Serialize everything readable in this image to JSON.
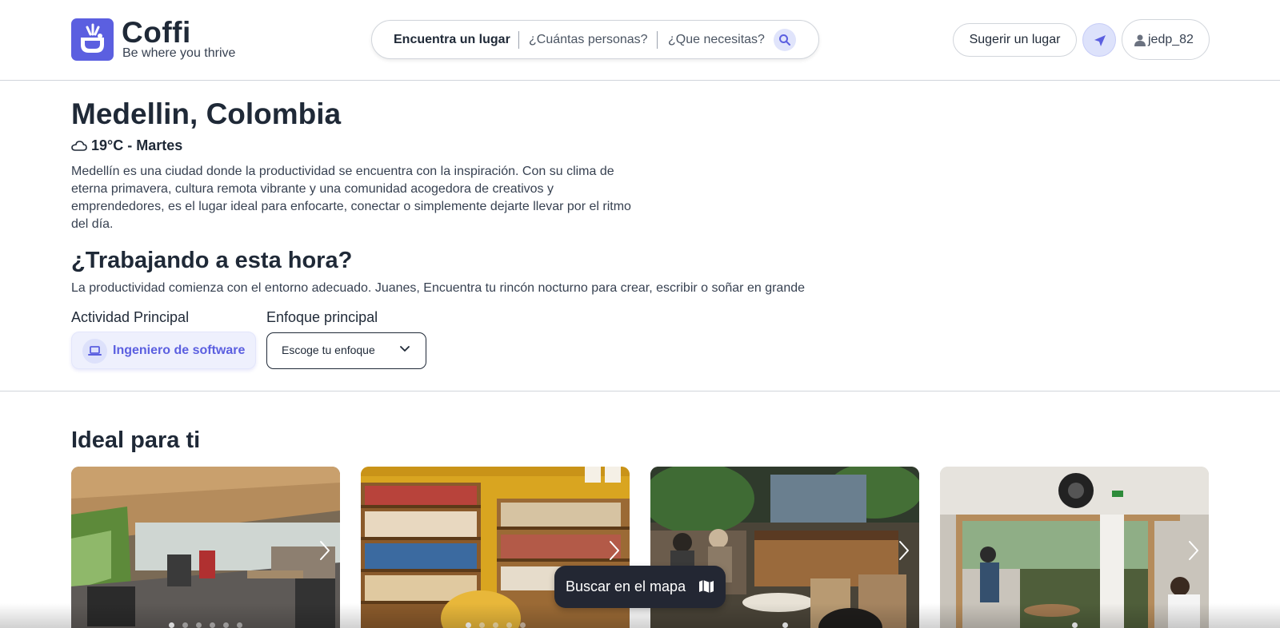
{
  "header": {
    "brand_name": "Coffi",
    "tagline": "Be where you thrive",
    "logo_icon": "cup-logo-icon",
    "search": {
      "place_label": "Encuentra un lugar",
      "people_label": "¿Cuántas personas?",
      "needs_label": "¿Que necesitas?",
      "search_icon": "search-icon"
    },
    "suggest_label": "Sugerir un lugar",
    "location_icon": "navigation-arrow-icon",
    "user_icon": "user-icon",
    "username": "jedp_82"
  },
  "city": {
    "title": "Medellin, Colombia",
    "weather_icon": "cloud-icon",
    "weather": "19°C - Martes",
    "description": "Medellín es una ciudad donde la productividad se encuentra con la inspiración. Con su clima de eterna primavera, cultura remota vibrante y una comunidad acogedora de creativos y emprendedores, es el lugar ideal para enfocarte, conectar o simplemente dejarte llevar por el ritmo del día."
  },
  "working": {
    "title": "¿Trabajando a esta hora?",
    "subtitle": "La productividad comienza con el entorno adecuado. Juanes, Encuentra tu rincón nocturno para crear, escribir o soñar en grande"
  },
  "activity": {
    "label": "Actividad Principal",
    "chip_icon": "laptop-icon",
    "chip_label": "Ingeniero de software"
  },
  "focus": {
    "label": "Enfoque principal",
    "value": "Escoge tu enfoque",
    "chevron_icon": "chevron-down-icon"
  },
  "ideal": {
    "title": "Ideal para ti",
    "cards": [
      {
        "photo": "terrace-cafe-photo",
        "dot_count": 6,
        "active_dot": 0
      },
      {
        "photo": "bookshelf-cafe-photo",
        "dot_count": 5,
        "active_dot": 0
      },
      {
        "photo": "bar-cafe-photo",
        "dot_count": 1,
        "active_dot": 0
      },
      {
        "photo": "garden-cafe-photo",
        "dot_count": 1,
        "active_dot": 0
      }
    ]
  },
  "map_button": {
    "label": "Buscar en el mapa",
    "icon": "map-icon"
  },
  "colors": {
    "accent": "#5b5fe0",
    "accent_light": "#eef0fd",
    "text_dark": "#1f2937",
    "dark_button": "#232733"
  }
}
